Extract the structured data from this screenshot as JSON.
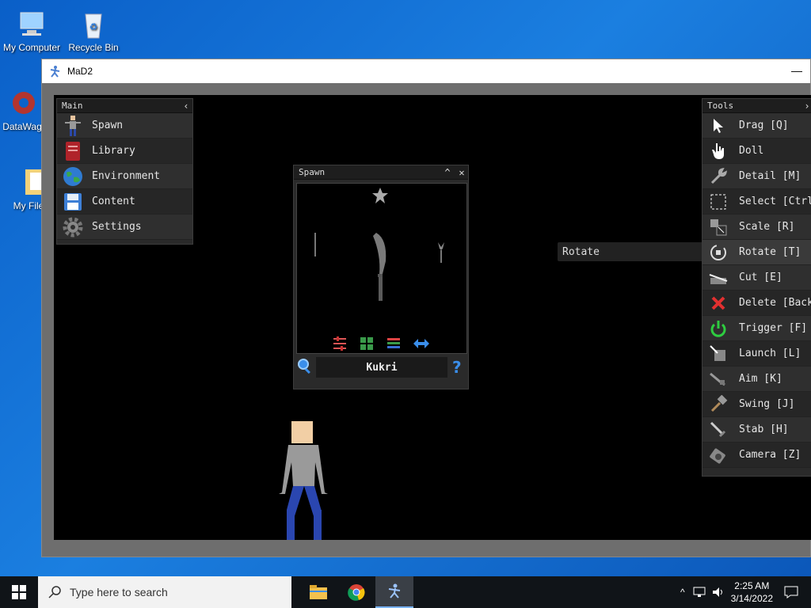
{
  "desktop": {
    "icons": [
      {
        "label": "My Computer"
      },
      {
        "label": "Recycle Bin"
      },
      {
        "label": "DataWag"
      },
      {
        "label": "My File"
      }
    ]
  },
  "window": {
    "title": "MaD2",
    "minimize": "—"
  },
  "main_panel": {
    "title": "Main",
    "collapse": "‹",
    "items": [
      {
        "label": "Spawn",
        "icon": "ragdoll-icon"
      },
      {
        "label": "Library",
        "icon": "book-icon"
      },
      {
        "label": "Environment",
        "icon": "globe-icon"
      },
      {
        "label": "Content",
        "icon": "floppy-icon"
      },
      {
        "label": "Settings",
        "icon": "gear-icon"
      }
    ]
  },
  "spawn_panel": {
    "title": "Spawn",
    "collapse": "^",
    "close": "✕",
    "selected_item": "Kukri",
    "help": "?"
  },
  "tools_panel": {
    "title": "Tools",
    "collapse": "›",
    "items": [
      {
        "label": "Drag [Q]"
      },
      {
        "label": "Doll"
      },
      {
        "label": "Detail [M]"
      },
      {
        "label": "Select [Ctrl"
      },
      {
        "label": "Scale [R]"
      },
      {
        "label": "Rotate [T]"
      },
      {
        "label": "Cut [E]"
      },
      {
        "label": "Delete [Back"
      },
      {
        "label": "Trigger [F]"
      },
      {
        "label": "Launch [L]"
      },
      {
        "label": "Aim [K]"
      },
      {
        "label": "Swing [J]"
      },
      {
        "label": "Stab [H]"
      },
      {
        "label": "Camera [Z]"
      }
    ]
  },
  "tooltip": "Rotate",
  "taskbar": {
    "search_placeholder": "Type here to search",
    "time": "2:25 AM",
    "date": "3/14/2022"
  },
  "colors": {
    "desktop": "#0b63c9",
    "viewport": "#000000",
    "panel": "#2a2a2a",
    "delete_red": "#e23030",
    "trigger_green": "#2ecc40",
    "accent_blue": "#3a8eea"
  }
}
